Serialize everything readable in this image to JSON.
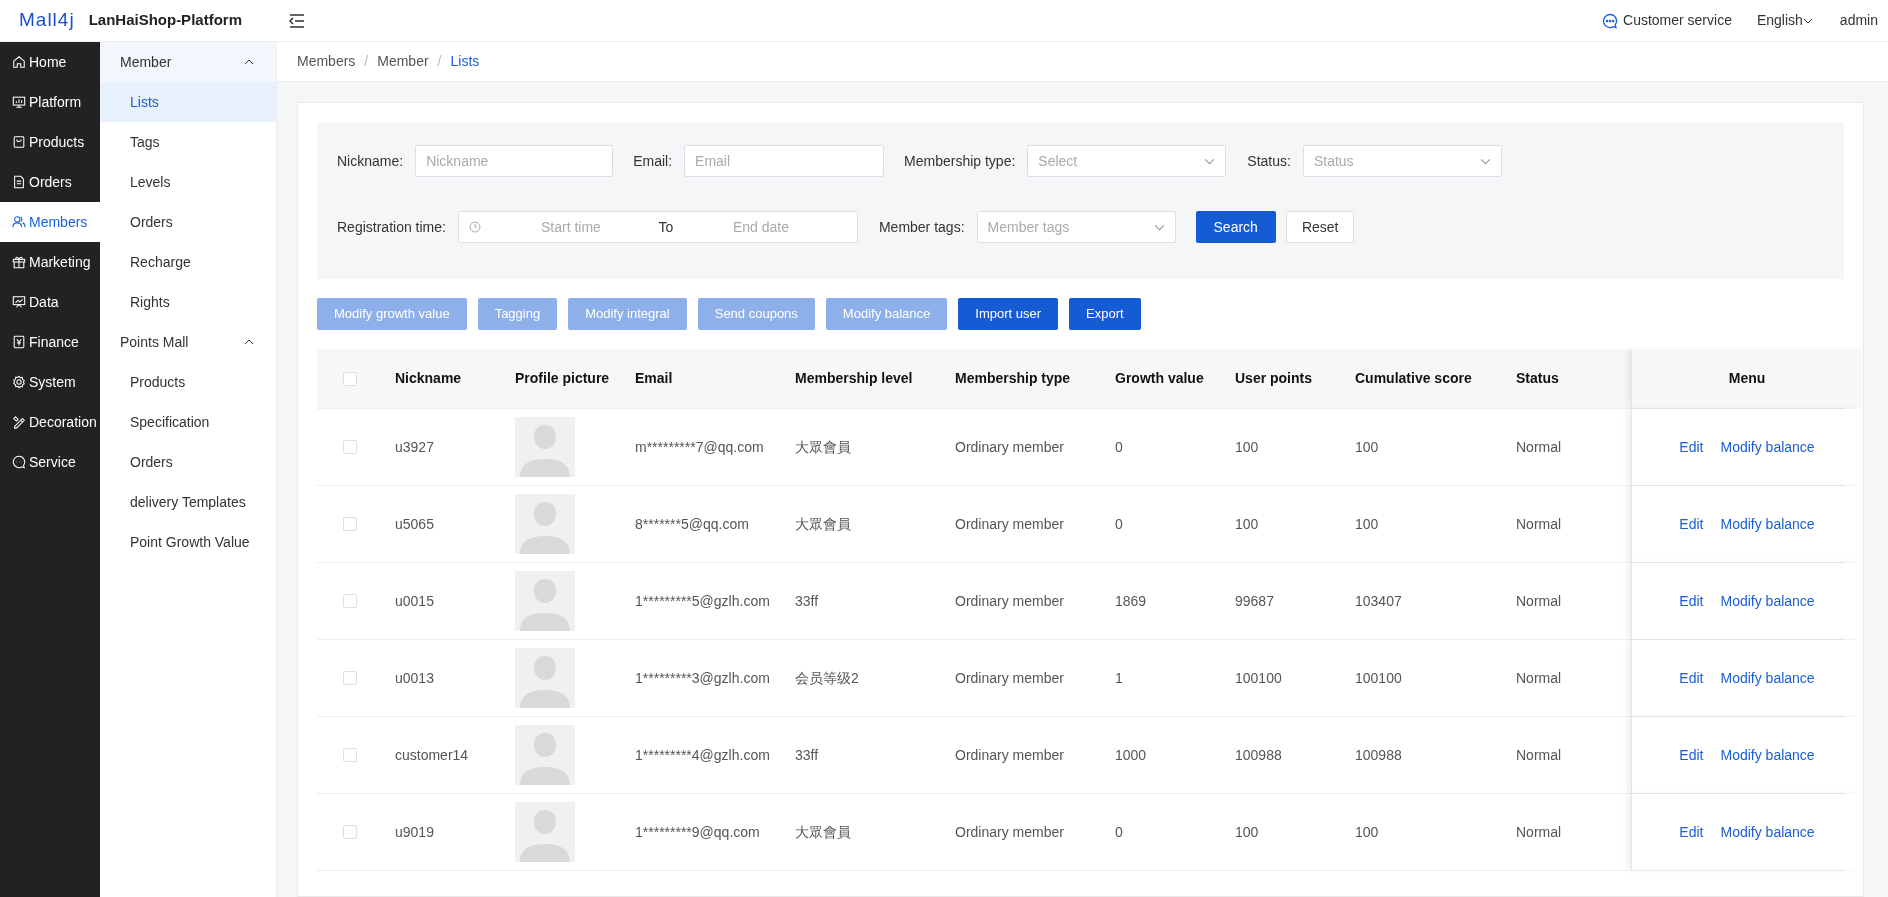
{
  "header": {
    "logo": "Mall4j",
    "title": "LanHaiShop-Platform",
    "customer_service": "Customer service",
    "language": "English",
    "user": "admin"
  },
  "nav": [
    {
      "label": "Home",
      "selected": false
    },
    {
      "label": "Platform",
      "selected": false
    },
    {
      "label": "Products",
      "selected": false
    },
    {
      "label": "Orders",
      "selected": false
    },
    {
      "label": "Members",
      "selected": true
    },
    {
      "label": "Marketing",
      "selected": false
    },
    {
      "label": "Data",
      "selected": false
    },
    {
      "label": "Finance",
      "selected": false
    },
    {
      "label": "System",
      "selected": false
    },
    {
      "label": "Decoration",
      "selected": false
    },
    {
      "label": "Service",
      "selected": false
    }
  ],
  "submenu": [
    {
      "label": "Member",
      "expanded": true,
      "children": [
        {
          "label": "Lists",
          "selected": true
        },
        {
          "label": "Tags",
          "selected": false
        },
        {
          "label": "Levels",
          "selected": false
        },
        {
          "label": "Orders",
          "selected": false
        },
        {
          "label": "Recharge",
          "selected": false
        },
        {
          "label": "Rights",
          "selected": false
        }
      ]
    },
    {
      "label": "Points Mall",
      "expanded": true,
      "children": [
        {
          "label": "Products",
          "selected": false
        },
        {
          "label": "Specification",
          "selected": false
        },
        {
          "label": "Orders",
          "selected": false
        },
        {
          "label": "delivery Templates",
          "selected": false
        },
        {
          "label": "Point Growth Value",
          "selected": false
        }
      ]
    }
  ],
  "breadcrumb": {
    "separator": "/",
    "items": [
      "Members",
      "Member",
      "Lists"
    ]
  },
  "filters": {
    "nickname": {
      "label": "Nickname:",
      "placeholder": "Nickname"
    },
    "email": {
      "label": "Email:",
      "placeholder": "Email"
    },
    "membership_type": {
      "label": "Membership type:",
      "placeholder": "Select"
    },
    "status": {
      "label": "Status:",
      "placeholder": "Status"
    },
    "registration_time": {
      "label": "Registration time:",
      "start_placeholder": "Start time",
      "separator": "To",
      "end_placeholder": "End date"
    },
    "member_tags": {
      "label": "Member tags:",
      "placeholder": "Member tags"
    },
    "search": "Search",
    "reset": "Reset"
  },
  "actions": [
    {
      "label": "Modify growth value",
      "disabled": true
    },
    {
      "label": "Tagging",
      "disabled": true
    },
    {
      "label": "Modify integral",
      "disabled": true
    },
    {
      "label": "Send coupons",
      "disabled": true
    },
    {
      "label": "Modify balance",
      "disabled": true
    },
    {
      "label": "Import user",
      "disabled": false
    },
    {
      "label": "Export",
      "disabled": false
    }
  ],
  "table": {
    "select_all": {
      "checked": false
    },
    "columns": [
      "Nickname",
      "Profile picture",
      "Email",
      "Membership level",
      "Membership type",
      "Growth value",
      "User points",
      "Cumulative score",
      "Status",
      "Menu"
    ],
    "rows": [
      {
        "checked": false,
        "nickname": "u3927",
        "email": "m*********7@qq.com",
        "level": "大眾會員",
        "type": "Ordinary member",
        "growth": "0",
        "points": "100",
        "cumulative": "100",
        "status": "Normal",
        "actions": [
          "Edit",
          "Modify balance"
        ]
      },
      {
        "checked": false,
        "nickname": "u5065",
        "email": "8*******5@qq.com",
        "level": "大眾會員",
        "type": "Ordinary member",
        "growth": "0",
        "points": "100",
        "cumulative": "100",
        "status": "Normal",
        "actions": [
          "Edit",
          "Modify balance"
        ]
      },
      {
        "checked": false,
        "nickname": "u0015",
        "email": "1*********5@gzlh.com",
        "level": "33ff",
        "type": "Ordinary member",
        "growth": "1869",
        "points": "99687",
        "cumulative": "103407",
        "status": "Normal",
        "actions": [
          "Edit",
          "Modify balance"
        ]
      },
      {
        "checked": false,
        "nickname": "u0013",
        "email": "1*********3@gzlh.com",
        "level": "会员等级2",
        "type": "Ordinary member",
        "growth": "1",
        "points": "100100",
        "cumulative": "100100",
        "status": "Normal",
        "actions": [
          "Edit",
          "Modify balance"
        ]
      },
      {
        "checked": false,
        "nickname": "customer14",
        "email": "1*********4@gzlh.com",
        "level": "33ff",
        "type": "Ordinary member",
        "growth": "1000",
        "points": "100988",
        "cumulative": "100988",
        "status": "Normal",
        "actions": [
          "Edit",
          "Modify balance"
        ]
      },
      {
        "checked": false,
        "nickname": "u9019",
        "email": "1*********9@qq.com",
        "level": "大眾會員",
        "type": "Ordinary member",
        "growth": "0",
        "points": "100",
        "cumulative": "100",
        "status": "Normal",
        "actions": [
          "Edit",
          "Modify balance"
        ]
      }
    ]
  }
}
